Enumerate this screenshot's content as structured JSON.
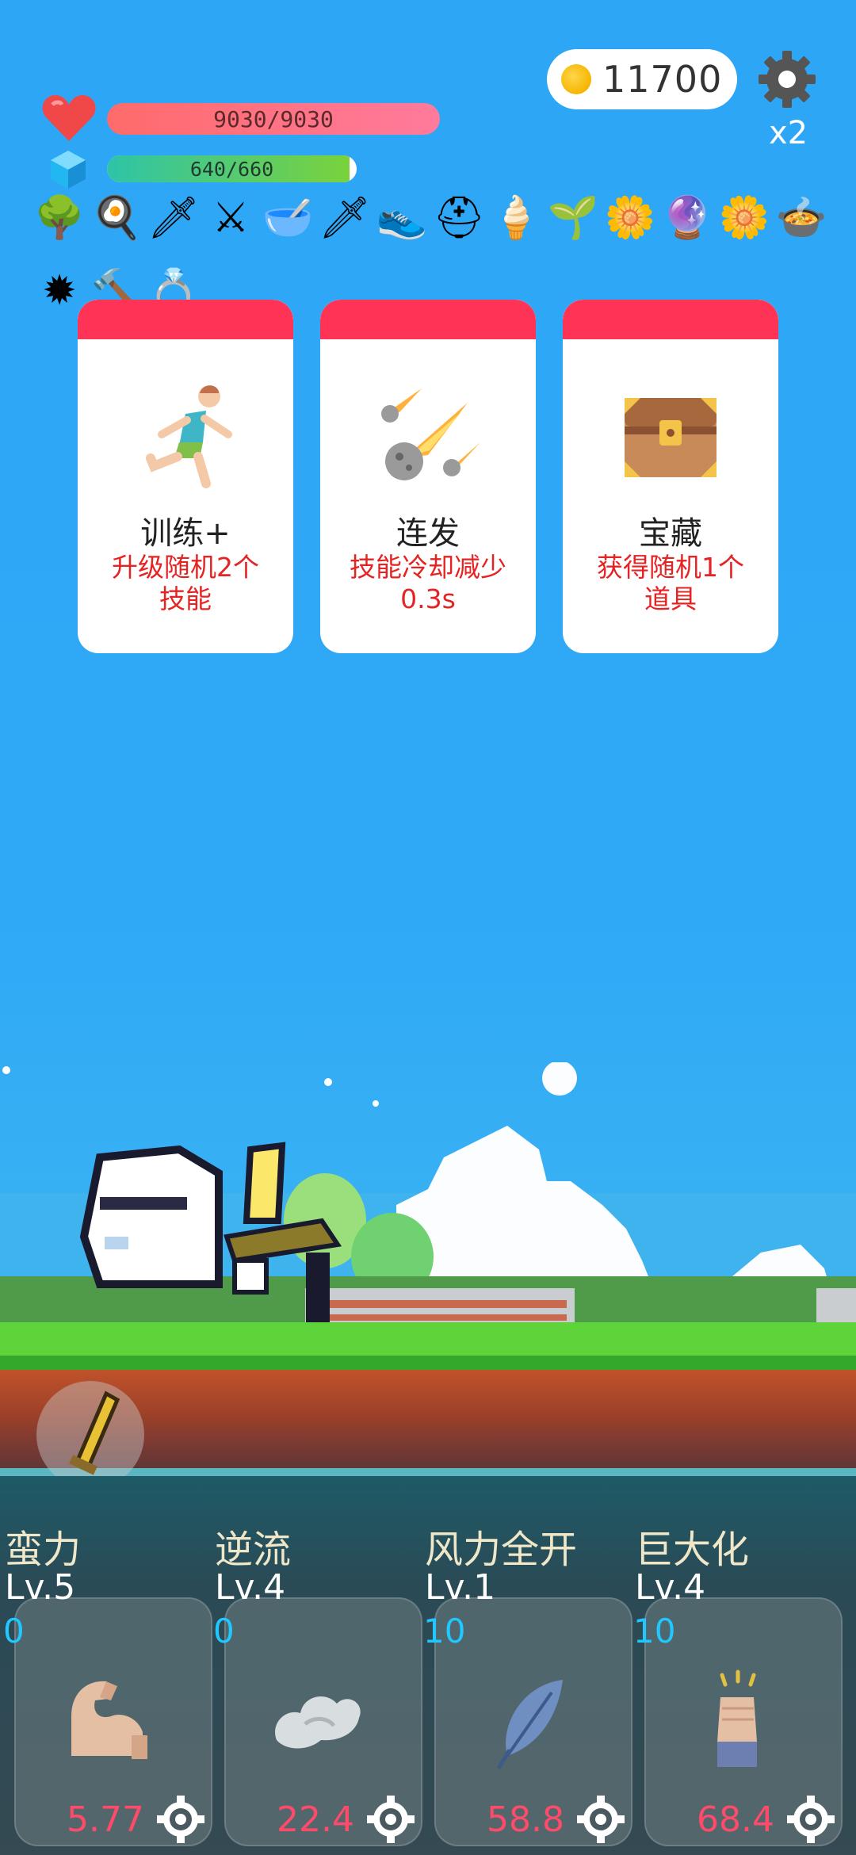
{
  "hud": {
    "coins": "11700",
    "speed": "x2",
    "hp_text": "9030/9030",
    "hp_fraction": 1.0,
    "mp_text": "640/660",
    "mp_fraction": 0.97
  },
  "items": [
    {
      "icon": "tree-icon",
      "glyph": "🌳"
    },
    {
      "icon": "fried-egg-icon",
      "glyph": "🍳"
    },
    {
      "icon": "dagger-icon",
      "glyph": "🗡"
    },
    {
      "icon": "sword-icon",
      "glyph": "⚔"
    },
    {
      "icon": "mortar-icon",
      "glyph": "🥣"
    },
    {
      "icon": "short-sword-icon",
      "glyph": "🗡"
    },
    {
      "icon": "sneaker-icon",
      "glyph": "👟"
    },
    {
      "icon": "helmet-icon",
      "glyph": "⛑"
    },
    {
      "icon": "ice-cream-icon",
      "glyph": "🍦"
    },
    {
      "icon": "sapling-icon",
      "glyph": "🌱"
    },
    {
      "icon": "daisy-icon",
      "glyph": "🌼"
    },
    {
      "icon": "crystal-ball-icon",
      "glyph": "🔮"
    },
    {
      "icon": "white-flower-icon",
      "glyph": "🌼"
    },
    {
      "icon": "cauldron-icon",
      "glyph": "🍲"
    },
    {
      "icon": "spiked-ball-icon",
      "glyph": "✹"
    },
    {
      "icon": "hammer-icon",
      "glyph": "🔨"
    },
    {
      "icon": "ring-icon",
      "glyph": "💍"
    }
  ],
  "cards": [
    {
      "icon": "runner-icon",
      "title": "训练+",
      "desc_line1": "升级随机2个",
      "desc_line2": "技能"
    },
    {
      "icon": "meteor-icon",
      "title": "连发",
      "desc_line1": "技能冷却减少",
      "desc_line2": "0.3s"
    },
    {
      "icon": "treasure-chest-icon",
      "title": "宝藏",
      "desc_line1": "获得随机1个",
      "desc_line2": "道具"
    }
  ],
  "skills": [
    {
      "name": "蛮力",
      "level": "Lv.5",
      "count": "0",
      "cooldown": "5.77",
      "icon": "muscle-arm-icon"
    },
    {
      "name": "逆流",
      "level": "Lv.4",
      "count": "0",
      "cooldown": "22.4",
      "icon": "wind-cloud-icon"
    },
    {
      "name": "风力全开",
      "level": "Lv.1",
      "count": "10",
      "cooldown": "58.8",
      "icon": "feather-icon"
    },
    {
      "name": "巨大化",
      "level": "Lv.4",
      "count": "10",
      "cooldown": "68.4",
      "icon": "fist-icon"
    }
  ],
  "colors": {
    "card_header": "#ff3355",
    "card_desc": "#e62222",
    "skill_count": "#21c7ff",
    "skill_cooldown": "#ff4a6a"
  }
}
